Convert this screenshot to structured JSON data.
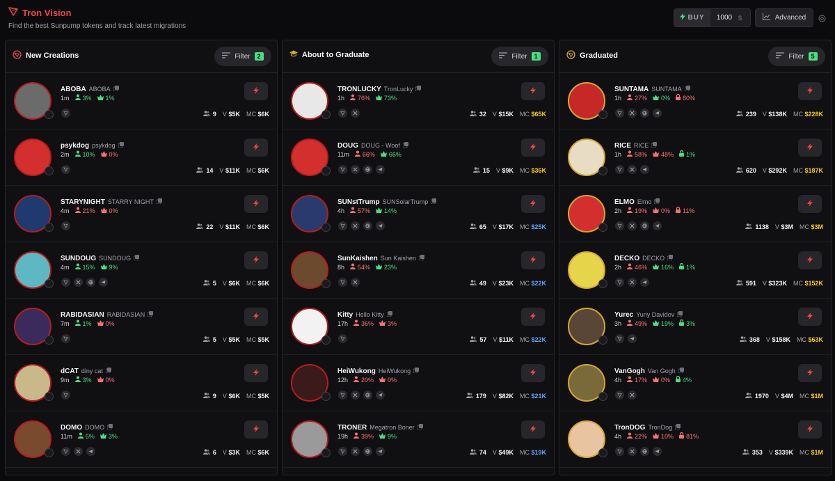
{
  "app": {
    "title": "Tron Vision",
    "tagline": "Find the best Sunpump tokens and track latest migrations",
    "buy_label": "BUY",
    "buy_amount": "1000",
    "buy_currency": "$",
    "advanced_label": "Advanced"
  },
  "colors": {
    "accent": "#ef4444",
    "green": "#4ade80",
    "red": "#f87171",
    "mc_yellow": "#facc15",
    "mc_blue": "#60a5fa"
  },
  "columns": [
    {
      "title": "New Creations",
      "filter_label": "Filter",
      "filter_count": "2",
      "tokens": [
        {
          "symbol": "ABOBA",
          "name": "ABOBA",
          "age": "1m",
          "s1": "3%",
          "s1c": "green",
          "s2": "1%",
          "s2c": "green",
          "s3": "",
          "holders": "9",
          "vol_label": "V",
          "vol": "$5K",
          "mc_label": "MC",
          "mc": "$6K",
          "mc_color": "white",
          "social": [
            "tron"
          ],
          "avatar_bg": "#6b6b6b",
          "border": "red"
        },
        {
          "symbol": "psykdog",
          "name": "psykdog",
          "age": "2m",
          "s1": "10%",
          "s1c": "green",
          "s2": "0%",
          "s2c": "red",
          "s3": "",
          "holders": "14",
          "vol_label": "V",
          "vol": "$11K",
          "mc_label": "MC",
          "mc": "$6K",
          "mc_color": "white",
          "social": [
            "tron"
          ],
          "avatar_bg": "#d32f2f",
          "border": "red"
        },
        {
          "symbol": "STARYNIGHT",
          "name": "STARRY NIGHT",
          "age": "4m",
          "s1": "21%",
          "s1c": "red",
          "s2": "0%",
          "s2c": "red",
          "s3": "",
          "holders": "22",
          "vol_label": "V",
          "vol": "$11K",
          "mc_label": "MC",
          "mc": "$6K",
          "mc_color": "white",
          "social": [
            "tron"
          ],
          "avatar_bg": "#1e3a6e",
          "border": "red"
        },
        {
          "symbol": "SUNDOUG",
          "name": "SUNDOUG",
          "age": "4m",
          "s1": "15%",
          "s1c": "green",
          "s2": "9%",
          "s2c": "green",
          "s3": "",
          "holders": "5",
          "vol_label": "V",
          "vol": "$6K",
          "mc_label": "MC",
          "mc": "$6K",
          "mc_color": "white",
          "social": [
            "tron",
            "x",
            "web",
            "telegram"
          ],
          "avatar_bg": "#5eb8c4",
          "border": "red"
        },
        {
          "symbol": "RABIDASIAN",
          "name": "RABIDASIAN",
          "age": "7m",
          "s1": "1%",
          "s1c": "green",
          "s2": "0%",
          "s2c": "red",
          "s3": "",
          "holders": "5",
          "vol_label": "V",
          "vol": "$5K",
          "mc_label": "MC",
          "mc": "$5K",
          "mc_color": "white",
          "social": [
            "tron"
          ],
          "avatar_bg": "#3b2a5c",
          "border": "red"
        },
        {
          "symbol": "dCAT",
          "name": "diny cat",
          "age": "9m",
          "s1": "3%",
          "s1c": "green",
          "s2": "0%",
          "s2c": "red",
          "s3": "",
          "holders": "9",
          "vol_label": "V",
          "vol": "$6K",
          "mc_label": "MC",
          "mc": "$5K",
          "mc_color": "white",
          "social": [
            "tron"
          ],
          "avatar_bg": "#c9b98a",
          "border": "red"
        },
        {
          "symbol": "DOMO",
          "name": "DOMO",
          "age": "11m",
          "s1": "5%",
          "s1c": "green",
          "s2": "3%",
          "s2c": "green",
          "s3": "",
          "holders": "6",
          "vol_label": "V",
          "vol": "$3K",
          "mc_label": "MC",
          "mc": "$6K",
          "mc_color": "white",
          "social": [
            "tron",
            "x",
            "telegram"
          ],
          "avatar_bg": "#7a4a2e",
          "border": "red"
        }
      ]
    },
    {
      "title": "About to Graduate",
      "filter_label": "Filter",
      "filter_count": "1",
      "tokens": [
        {
          "symbol": "TRONLUCKY",
          "name": "TronLucky",
          "age": "1h",
          "s1": "76%",
          "s1c": "red",
          "s2": "73%",
          "s2c": "green",
          "s3": "",
          "holders": "32",
          "vol_label": "V",
          "vol": "$15K",
          "mc_label": "MC",
          "mc": "$65K",
          "mc_color": "yellow",
          "social": [
            "tron",
            "x"
          ],
          "avatar_bg": "#e8e8e8",
          "border": "red"
        },
        {
          "symbol": "DOUG",
          "name": "DOUG - Woof",
          "age": "11m",
          "s1": "66%",
          "s1c": "red",
          "s2": "66%",
          "s2c": "green",
          "s3": "",
          "holders": "15",
          "vol_label": "V",
          "vol": "$9K",
          "mc_label": "MC",
          "mc": "$36K",
          "mc_color": "yellow",
          "social": [
            "tron",
            "x",
            "web",
            "telegram"
          ],
          "avatar_bg": "#d32f2f",
          "border": "red"
        },
        {
          "symbol": "SUNstTrump",
          "name": "SUNSolarTrump",
          "age": "4h",
          "s1": "57%",
          "s1c": "red",
          "s2": "14%",
          "s2c": "green",
          "s3": "",
          "holders": "65",
          "vol_label": "V",
          "vol": "$17K",
          "mc_label": "MC",
          "mc": "$25K",
          "mc_color": "blue",
          "social": [
            "tron",
            "x",
            "web",
            "telegram"
          ],
          "avatar_bg": "#2b3a6e",
          "border": "red"
        },
        {
          "symbol": "SunKaishen",
          "name": "Sun Kaishen",
          "age": "8h",
          "s1": "54%",
          "s1c": "red",
          "s2": "23%",
          "s2c": "green",
          "s3": "",
          "holders": "49",
          "vol_label": "V",
          "vol": "$23K",
          "mc_label": "MC",
          "mc": "$22K",
          "mc_color": "blue",
          "social": [
            "tron",
            "x"
          ],
          "avatar_bg": "#6b4a2e",
          "border": "red"
        },
        {
          "symbol": "Kitty",
          "name": "Hello Kitty",
          "age": "17h",
          "s1": "36%",
          "s1c": "red",
          "s2": "3%",
          "s2c": "red",
          "s3": "",
          "holders": "57",
          "vol_label": "V",
          "vol": "$11K",
          "mc_label": "MC",
          "mc": "$22K",
          "mc_color": "blue",
          "social": [
            "tron"
          ],
          "avatar_bg": "#f2f2f2",
          "border": "red"
        },
        {
          "symbol": "HeiWukong",
          "name": "HeiWukong",
          "age": "12h",
          "s1": "20%",
          "s1c": "red",
          "s2": "0%",
          "s2c": "red",
          "s3": "",
          "holders": "179",
          "vol_label": "V",
          "vol": "$82K",
          "mc_label": "MC",
          "mc": "$21K",
          "mc_color": "blue",
          "social": [
            "tron",
            "x",
            "web",
            "telegram"
          ],
          "avatar_bg": "#3a1a1a",
          "border": "red"
        },
        {
          "symbol": "TRONER",
          "name": "Megatron Boner",
          "age": "19h",
          "s1": "39%",
          "s1c": "red",
          "s2": "9%",
          "s2c": "green",
          "s3": "",
          "holders": "74",
          "vol_label": "V",
          "vol": "$49K",
          "mc_label": "MC",
          "mc": "$19K",
          "mc_color": "blue",
          "social": [
            "tron",
            "x",
            "web",
            "telegram"
          ],
          "avatar_bg": "#9a9a9a",
          "border": "red"
        }
      ]
    },
    {
      "title": "Graduated",
      "filter_label": "Filter",
      "filter_count": "5",
      "tokens": [
        {
          "symbol": "SUNTAMA",
          "name": "SUNTAMA",
          "age": "1h",
          "s1": "27%",
          "s1c": "red",
          "s2": "0%",
          "s2c": "green",
          "s3": "80%",
          "s3c": "red",
          "holders": "239",
          "vol_label": "V",
          "vol": "$138K",
          "mc_label": "MC",
          "mc": "$228K",
          "mc_color": "yellow",
          "social": [
            "tron",
            "x",
            "web",
            "telegram"
          ],
          "avatar_bg": "#c62828",
          "border": "gold"
        },
        {
          "symbol": "RICE",
          "name": "RICE",
          "age": "1h",
          "s1": "58%",
          "s1c": "red",
          "s2": "48%",
          "s2c": "red",
          "s3": "1%",
          "s3c": "green",
          "holders": "620",
          "vol_label": "V",
          "vol": "$292K",
          "mc_label": "MC",
          "mc": "$187K",
          "mc_color": "yellow",
          "social": [
            "tron",
            "x",
            "telegram"
          ],
          "avatar_bg": "#e8dcc4",
          "border": "gold"
        },
        {
          "symbol": "ELMO",
          "name": "Elmo",
          "age": "2h",
          "s1": "19%",
          "s1c": "red",
          "s2": "0%",
          "s2c": "red",
          "s3": "11%",
          "s3c": "red",
          "holders": "1138",
          "vol_label": "V",
          "vol": "$3M",
          "mc_label": "MC",
          "mc": "$3M",
          "mc_color": "yellow",
          "social": [
            "tron",
            "x",
            "web",
            "telegram"
          ],
          "avatar_bg": "#d32f2f",
          "border": "gold"
        },
        {
          "symbol": "DECKO",
          "name": "DECKO",
          "age": "2h",
          "s1": "46%",
          "s1c": "red",
          "s2": "16%",
          "s2c": "green",
          "s3": "1%",
          "s3c": "green",
          "holders": "591",
          "vol_label": "V",
          "vol": "$323K",
          "mc_label": "MC",
          "mc": "$152K",
          "mc_color": "yellow",
          "social": [
            "tron",
            "x",
            "telegram"
          ],
          "avatar_bg": "#e6d44a",
          "border": "gold"
        },
        {
          "symbol": "Yurec",
          "name": "Yuriy Davidov",
          "age": "3h",
          "s1": "49%",
          "s1c": "red",
          "s2": "19%",
          "s2c": "green",
          "s3": "3%",
          "s3c": "green",
          "holders": "368",
          "vol_label": "V",
          "vol": "$158K",
          "mc_label": "MC",
          "mc": "$63K",
          "mc_color": "yellow",
          "social": [
            "tron",
            "telegram"
          ],
          "avatar_bg": "#5a4636",
          "border": "gold"
        },
        {
          "symbol": "VanGogh",
          "name": "Van Gogh",
          "age": "4h",
          "s1": "17%",
          "s1c": "red",
          "s2": "0%",
          "s2c": "red",
          "s3": "4%",
          "s3c": "green",
          "holders": "1970",
          "vol_label": "V",
          "vol": "$4M",
          "mc_label": "MC",
          "mc": "$1M",
          "mc_color": "yellow",
          "social": [
            "tron",
            "x"
          ],
          "avatar_bg": "#7a6a3a",
          "border": "gold"
        },
        {
          "symbol": "TronDOG",
          "name": "TronDog",
          "age": "4h",
          "s1": "22%",
          "s1c": "red",
          "s2": "10%",
          "s2c": "red",
          "s3": "81%",
          "s3c": "red",
          "holders": "353",
          "vol_label": "V",
          "vol": "$339K",
          "mc_label": "MC",
          "mc": "$1M",
          "mc_color": "yellow",
          "social": [
            "tron",
            "x",
            "web",
            "telegram"
          ],
          "avatar_bg": "#e8c4a0",
          "border": "gold"
        }
      ]
    }
  ]
}
